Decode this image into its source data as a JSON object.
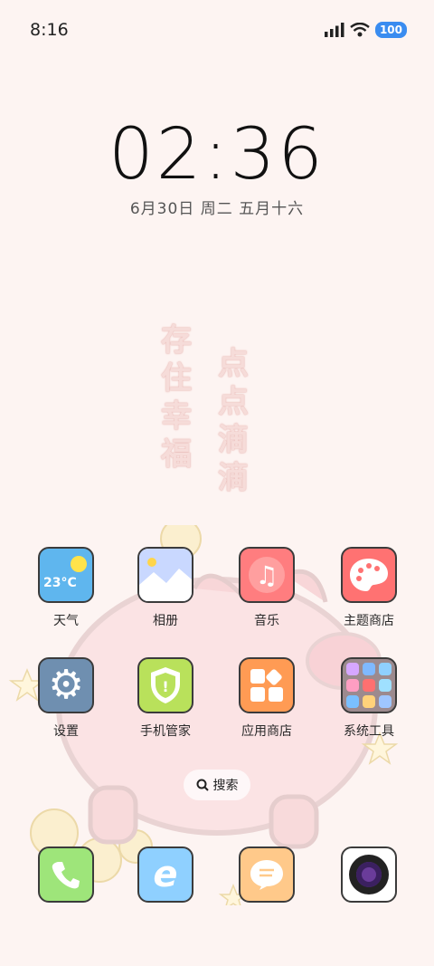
{
  "status_bar": {
    "time": "8:16",
    "battery": "100",
    "icons": [
      "signal-icon",
      "wifi-icon",
      "battery-icon"
    ]
  },
  "lock_clock": {
    "time": "02:36",
    "date": "6月30日 周二 五月十六"
  },
  "wallpaper_poem": {
    "left": [
      "存",
      "住",
      "幸",
      "福"
    ],
    "right": [
      "点",
      "点",
      "滴",
      "滴"
    ]
  },
  "apps": {
    "weather": {
      "label": "天气",
      "temp": "23°C"
    },
    "gallery": {
      "label": "相册"
    },
    "music": {
      "label": "音乐"
    },
    "theme_store": {
      "label": "主题商店"
    },
    "settings": {
      "label": "设置"
    },
    "security": {
      "label": "手机管家"
    },
    "app_store": {
      "label": "应用商店"
    },
    "system_tools": {
      "label": "系统工具"
    }
  },
  "search": {
    "label": "搜索"
  },
  "dock": [
    "phone-icon",
    "browser-icon",
    "messages-icon",
    "camera-icon"
  ]
}
